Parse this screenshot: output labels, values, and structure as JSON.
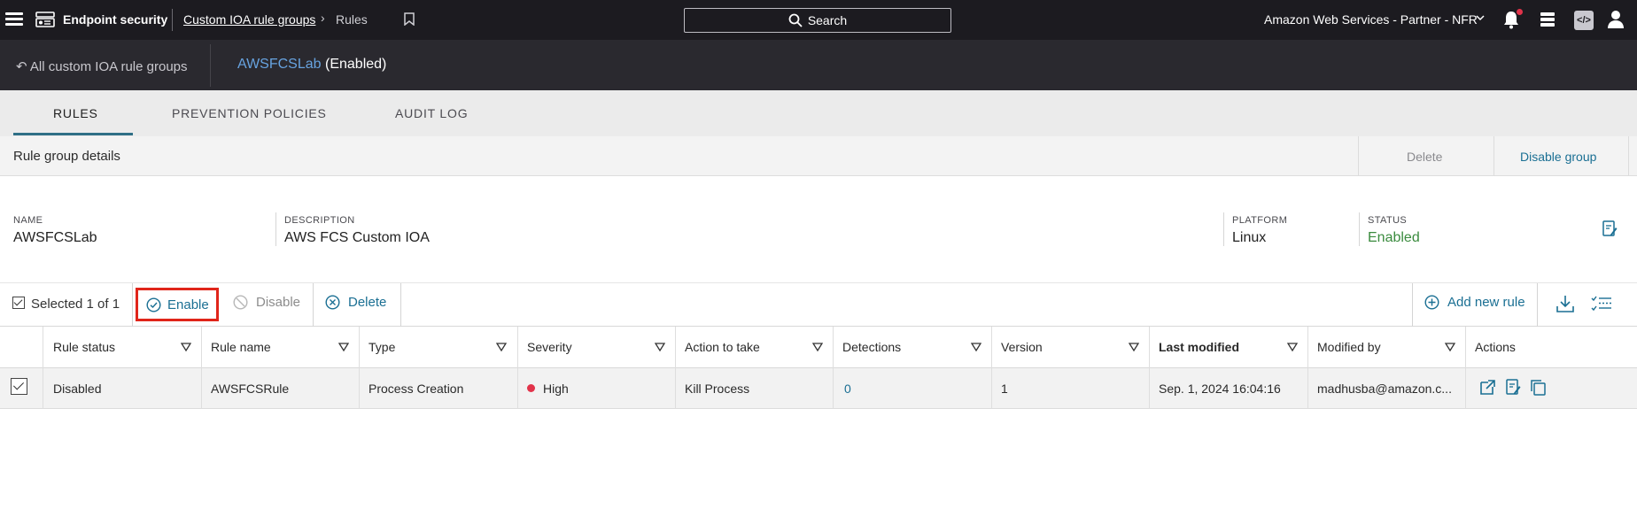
{
  "topbar": {
    "app_name": "Endpoint security",
    "breadcrumb_parent": "Custom IOA rule groups",
    "breadcrumb_current": "Rules",
    "search_label": "Search",
    "account": "Amazon Web Services - Partner - NFR"
  },
  "subbar": {
    "back_link": "All custom IOA rule groups",
    "group_name": "AWSFCSLab",
    "group_status": "(Enabled)"
  },
  "tabs": [
    {
      "label": "RULES",
      "active": true
    },
    {
      "label": "PREVENTION POLICIES",
      "active": false
    },
    {
      "label": "AUDIT LOG",
      "active": false
    }
  ],
  "details": {
    "title": "Rule group details",
    "delete_label": "Delete",
    "disable_label": "Disable group",
    "name_label": "NAME",
    "name_value": "AWSFCSLab",
    "description_label": "DESCRIPTION",
    "description_value": "AWS FCS Custom IOA",
    "platform_label": "PLATFORM",
    "platform_value": "Linux",
    "status_label": "STATUS",
    "status_value": "Enabled"
  },
  "toolbar": {
    "selected_text": "Selected 1 of 1",
    "enable_label": "Enable",
    "disable_label": "Disable",
    "delete_label": "Delete",
    "add_rule_label": "Add new rule"
  },
  "table": {
    "headers": [
      "Rule status",
      "Rule name",
      "Type",
      "Severity",
      "Action to take",
      "Detections",
      "Version",
      "Last modified",
      "Modified by",
      "Actions"
    ],
    "rows": [
      {
        "status": "Disabled",
        "name": "AWSFCSRule",
        "type": "Process Creation",
        "severity": "High",
        "action": "Kill Process",
        "detections": "0",
        "version": "1",
        "last_modified": "Sep. 1, 2024 16:04:16",
        "modified_by": "madhusba@amazon.c..."
      }
    ]
  },
  "colors": {
    "accent": "#1a6f93",
    "link_blue": "#67a3e0",
    "enabled_green": "#3a8b3e",
    "severity_high": "#e2334a",
    "highlight_red": "#e0251a"
  }
}
